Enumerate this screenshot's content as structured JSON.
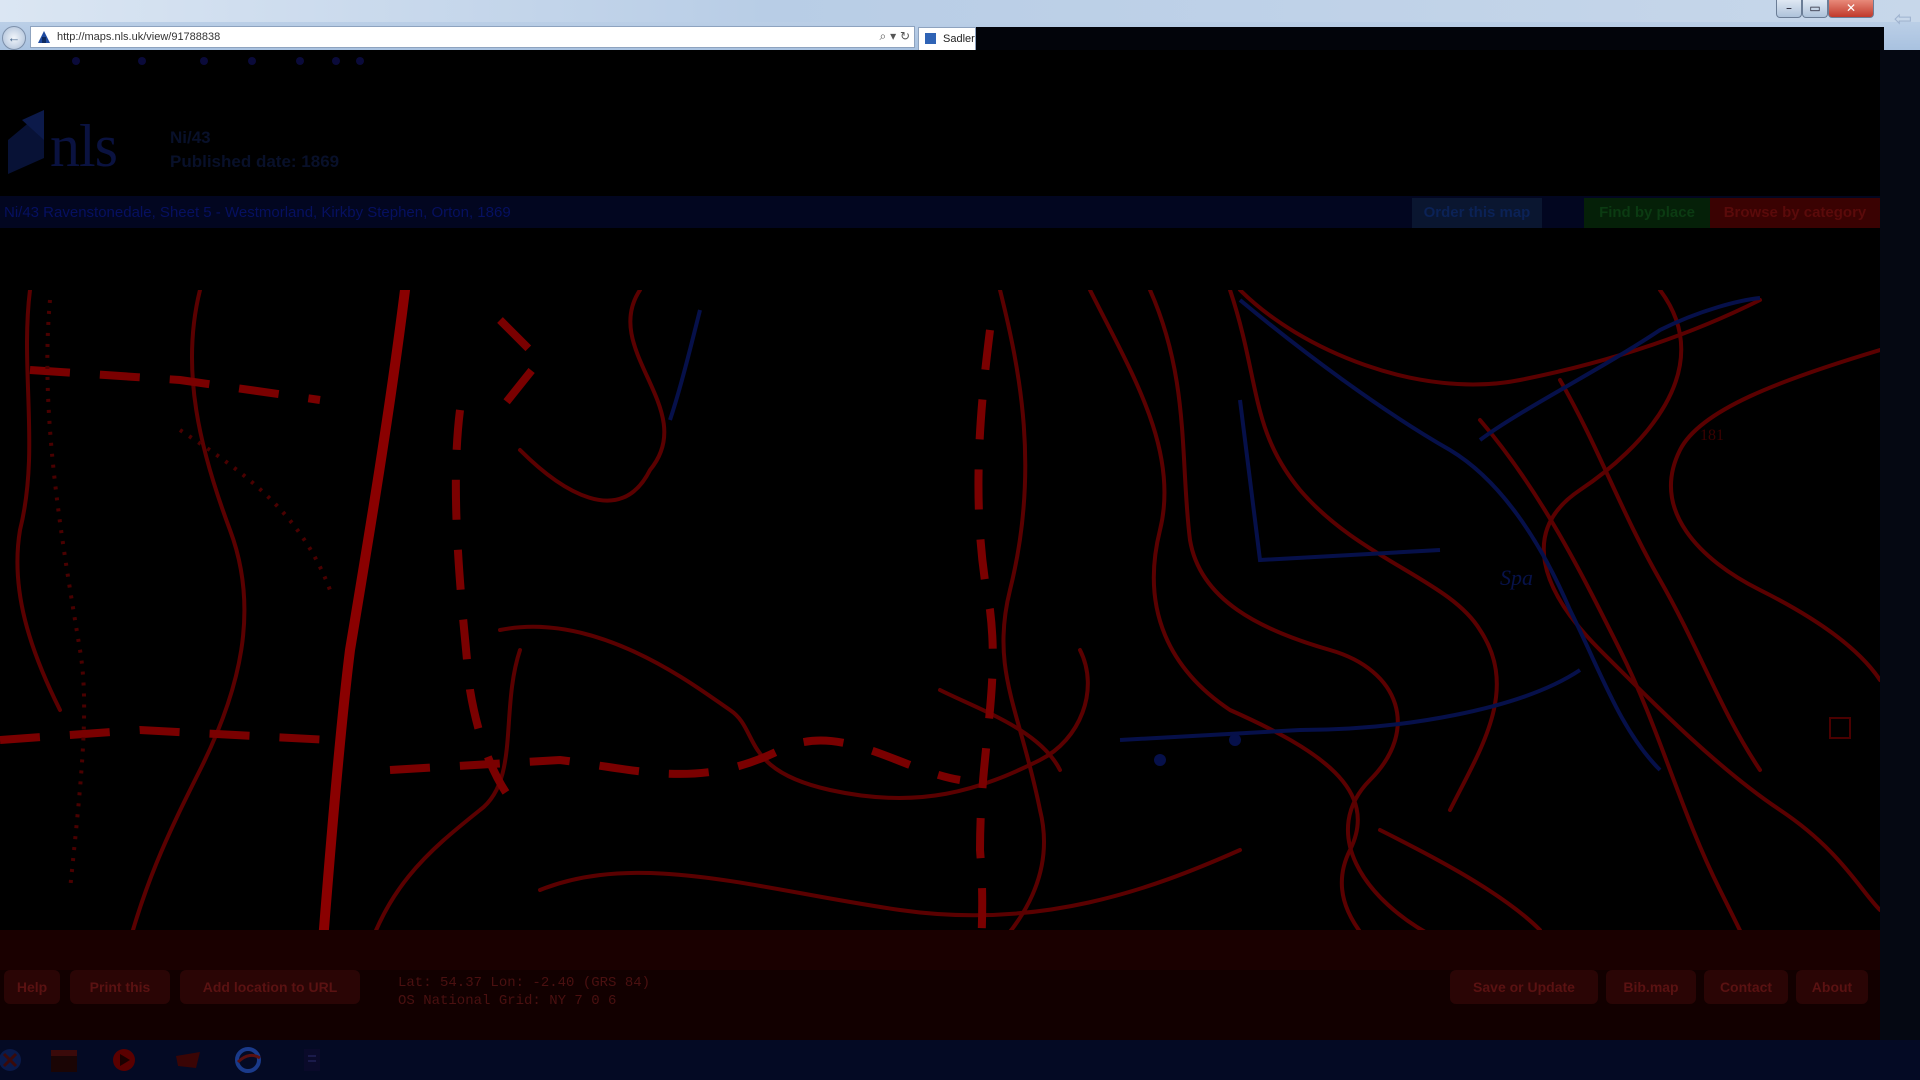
{
  "browser": {
    "url": "http://maps.nls.uk/view/91788838",
    "url_domain": "nls.uk",
    "tab_title": "Sadler",
    "nav_back_icon": "back-arrow-icon",
    "search_icon": "magnifier-icon",
    "refresh_icon": "refresh-icon",
    "window_controls": {
      "minimize": "–",
      "maximize": "▭",
      "close": "✕"
    }
  },
  "header": {
    "logo_text": "nls",
    "map_series": "Ni/43",
    "published": "Published date: 1869",
    "right_text": ""
  },
  "title_bar": {
    "map_title": "Ni/43 Ravenstonedale, Sheet 5 - Westmorland, Kirkby Stephen, Orton, 1869",
    "buttons": {
      "order": "Order this map",
      "find": "Find by place",
      "browse": "Browse by category"
    },
    "colors": {
      "order": "#0b2256",
      "find": "#0b3b12",
      "browse": "#5a0a0a"
    }
  },
  "map": {
    "label_bm": "181",
    "label_river": "Spa"
  },
  "footer": {
    "buttons_left": [
      "Help",
      "Print this",
      "Add location to URL"
    ],
    "coords_line1": "Lat: 54.37 Lon: -2.40 (GRS 84)",
    "coords_line2": "OS National Grid: NY 7 0 6",
    "buttons_right": [
      "Save or Update",
      "Bib.map",
      "Contact",
      "About"
    ]
  },
  "taskbar": {
    "icons": [
      "start-orb-icon",
      "calendar-icon",
      "media-player-icon",
      "game-icon",
      "browser-icon",
      "document-icon"
    ]
  }
}
